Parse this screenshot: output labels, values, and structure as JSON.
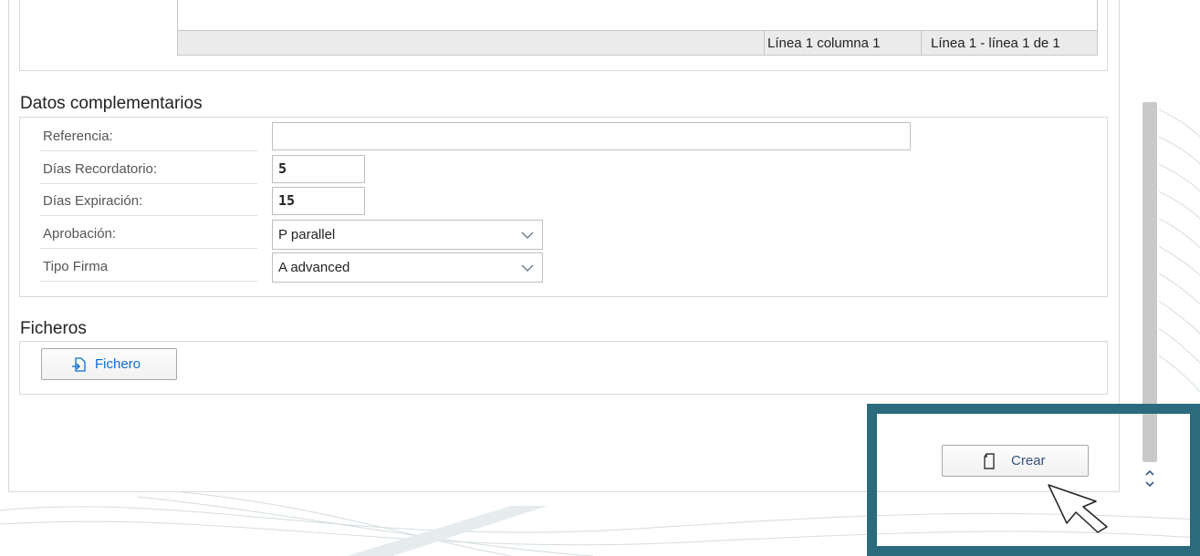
{
  "editor": {
    "status_position": "Línea 1 columna 1",
    "status_lines": "Línea 1 - línea 1 de 1"
  },
  "datos": {
    "title": "Datos complementarios",
    "rows": [
      {
        "label": "Referencia:",
        "value": ""
      },
      {
        "label": "Días Recordatorio:",
        "value": "5"
      },
      {
        "label": "Días Expiración:",
        "value": "15"
      },
      {
        "label": "Aprobación:",
        "value": "P parallel"
      },
      {
        "label": "Tipo Firma",
        "value": "A advanced"
      }
    ]
  },
  "ficheros": {
    "title": "Ficheros",
    "button_label": "Fichero",
    "button_icon": "upload-file-icon"
  },
  "actions": {
    "crear_label": "Crear",
    "crear_icon": "document-icon"
  },
  "colors": {
    "highlight": "#2b6b7d",
    "link_blue": "#0a6ed1"
  }
}
